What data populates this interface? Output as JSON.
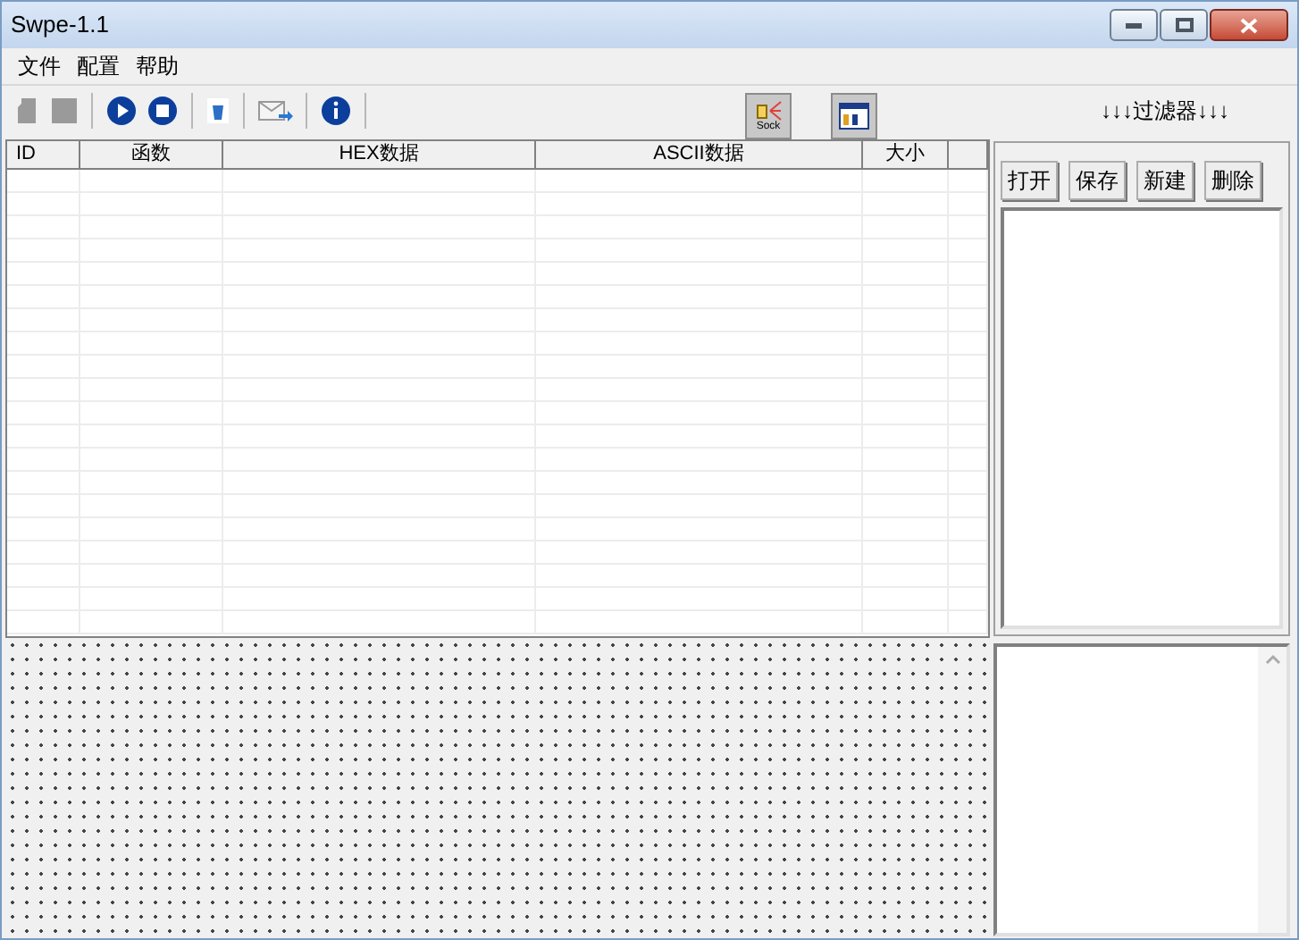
{
  "window": {
    "title": "Swpe-1.1"
  },
  "menu": [
    "文件",
    "配置",
    "帮助"
  ],
  "toolbar": [
    {
      "kind": "capture",
      "disabled": true
    },
    {
      "kind": "square",
      "disabled": true
    },
    {
      "kind": "sep"
    },
    {
      "kind": "play",
      "disabled": false
    },
    {
      "kind": "stop",
      "disabled": false
    },
    {
      "kind": "sep"
    },
    {
      "kind": "trash",
      "disabled": false
    },
    {
      "kind": "sep"
    },
    {
      "kind": "mail",
      "disabled": false
    },
    {
      "kind": "sep"
    },
    {
      "kind": "info",
      "disabled": false
    },
    {
      "kind": "sep"
    }
  ],
  "toggles": [
    {
      "kind": "sock",
      "label": "Sock",
      "selected": true
    },
    {
      "kind": "window",
      "selected": true
    }
  ],
  "filter": {
    "title": "↓↓↓过滤器↓↓↓",
    "buttons": [
      "打开",
      "保存",
      "新建",
      "删除"
    ]
  },
  "table": {
    "columns": [
      "ID",
      "函数",
      "HEX数据",
      "ASCII数据",
      "大小"
    ]
  }
}
